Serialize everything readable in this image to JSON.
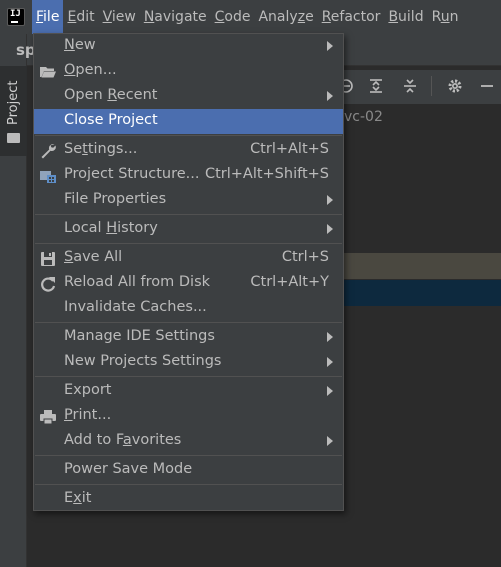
{
  "menubar": {
    "items": [
      {
        "pre": "",
        "u": "F",
        "post": "ile"
      },
      {
        "pre": "",
        "u": "E",
        "post": "dit"
      },
      {
        "pre": "",
        "u": "V",
        "post": "iew"
      },
      {
        "pre": "",
        "u": "N",
        "post": "avigate"
      },
      {
        "pre": "",
        "u": "C",
        "post": "ode"
      },
      {
        "pre": "Analy",
        "u": "z",
        "post": "e"
      },
      {
        "pre": "",
        "u": "R",
        "post": "efactor"
      },
      {
        "pre": "",
        "u": "B",
        "post": "uild"
      },
      {
        "pre": "R",
        "u": "u",
        "post": "n"
      }
    ]
  },
  "background": {
    "tab_text": "sp",
    "side_tab": "Project",
    "editor_text": "vc-02"
  },
  "file_menu": {
    "new": {
      "pre": "",
      "u": "N",
      "post": "ew"
    },
    "open": {
      "pre": "",
      "u": "O",
      "post": "pen..."
    },
    "open_recent": {
      "pre": "Open ",
      "u": "R",
      "post": "ecent"
    },
    "close_project": "Close Project",
    "settings": {
      "pre": "Se",
      "u": "t",
      "post": "tings...",
      "shortcut": "Ctrl+Alt+S"
    },
    "project_structure": {
      "label": "Project Structure...",
      "shortcut": "Ctrl+Alt+Shift+S"
    },
    "file_properties": "File Properties",
    "local_history": {
      "pre": "Local ",
      "u": "H",
      "post": "istory"
    },
    "save_all": {
      "pre": "",
      "u": "S",
      "post": "ave All",
      "shortcut": "Ctrl+S"
    },
    "reload_all": {
      "label": "Reload All from Disk",
      "shortcut": "Ctrl+Alt+Y"
    },
    "invalidate_caches": "Invalidate Caches...",
    "manage_ide_settings": "Manage IDE Settings",
    "new_projects_settings": "New Projects Settings",
    "export": "Export",
    "print": {
      "pre": "",
      "u": "P",
      "post": "rint..."
    },
    "add_to_favorites": {
      "pre": "Add to F",
      "u": "a",
      "post": "vorites"
    },
    "power_save_mode": "Power Save Mode",
    "exit": {
      "pre": "E",
      "u": "x",
      "post": "it"
    }
  },
  "colors": {
    "menu_bg": "#3c3f41",
    "selection": "#4b6eaf",
    "text": "#bbbbbb"
  },
  "icons": [
    "app-logo-icon",
    "open-folder-icon",
    "wrench-icon",
    "project-structure-icon",
    "save-all-icon",
    "reload-icon",
    "print-icon",
    "settings-gear-icon",
    "expand-all-icon",
    "collapse-all-icon",
    "minimize-icon"
  ]
}
